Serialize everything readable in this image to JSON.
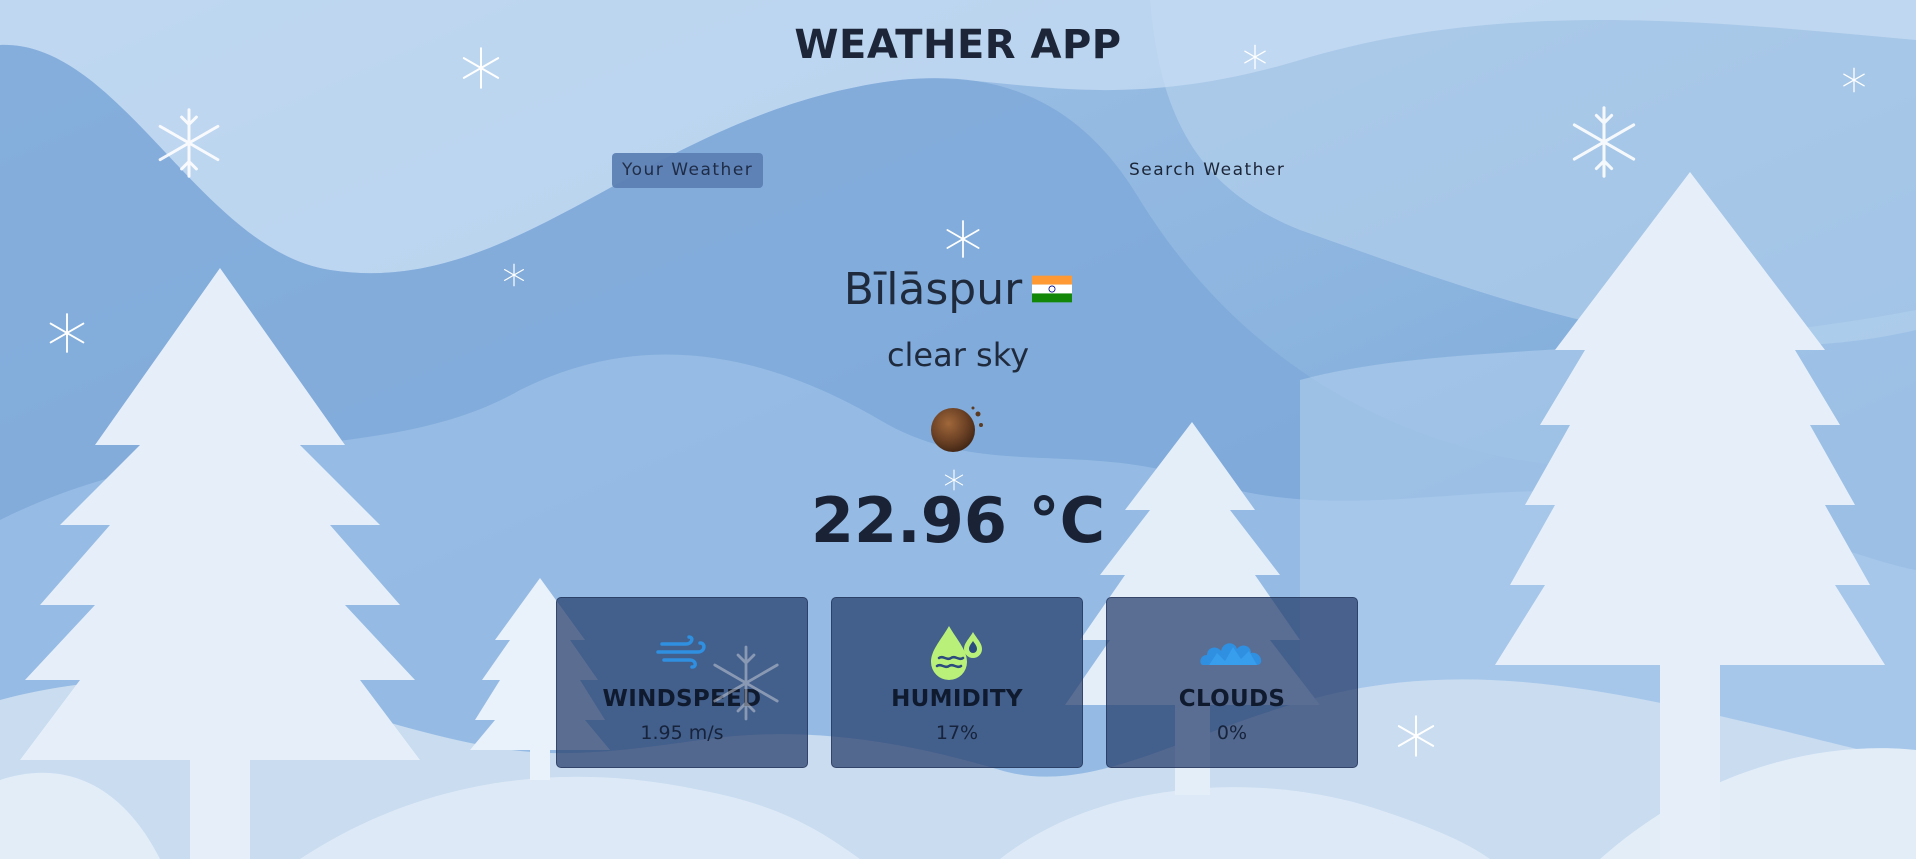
{
  "app": {
    "title": "WEATHER APP"
  },
  "tabs": [
    {
      "label": "Your Weather",
      "active": true
    },
    {
      "label": "Search Weather",
      "active": false
    }
  ],
  "weather": {
    "city": "Bīlāspur",
    "country_flag": "india-flag",
    "description": "clear sky",
    "icon": "clear-night-moon-icon",
    "temperature": "22.96 °C"
  },
  "stats": [
    {
      "icon": "wind-icon",
      "label": "WINDSPEED",
      "value": "1.95 m/s"
    },
    {
      "icon": "humidity-drops-icon",
      "label": "HUMIDITY",
      "value": "17%"
    },
    {
      "icon": "clouds-icon",
      "label": "CLOUDS",
      "value": "0%"
    }
  ],
  "colors": {
    "active_tab": "#5b7fb3",
    "card_bg": "#2d4a7e",
    "wind_icon": "#2f8fe0",
    "humidity_icon": "#b8f07a",
    "clouds_icon": "#2f8fe0"
  }
}
